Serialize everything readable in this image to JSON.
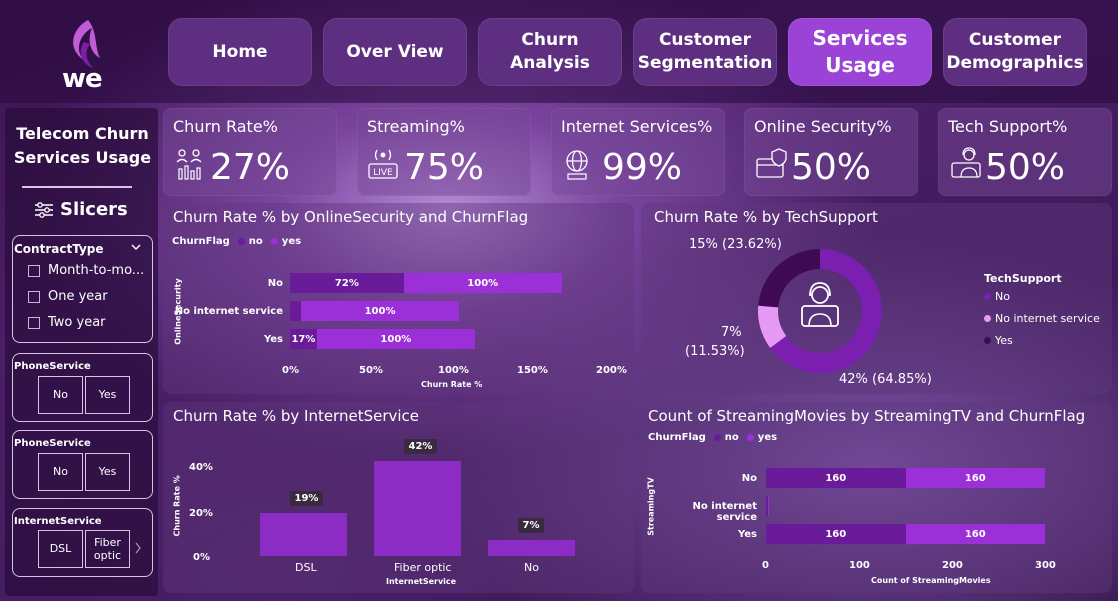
{
  "nav": {
    "home": "Home",
    "overview": "Over View",
    "churn_analysis": "Churn Analysis",
    "customer_segmentation": "Customer Segmentation",
    "services_usage": "Services Usage",
    "customer_demographics": "Customer Demographics"
  },
  "brand": {
    "logo_text": "we"
  },
  "sidebar": {
    "title": "Telecom Churn Services Usage",
    "slicers_label": "Slicers",
    "contract": {
      "title": "ContractType",
      "options": [
        "Month-to-mo...",
        "One year",
        "Two year"
      ]
    },
    "phone1": {
      "title": "PhoneService",
      "options": [
        "No",
        "Yes"
      ]
    },
    "phone2": {
      "title": "PhoneService",
      "options": [
        "No",
        "Yes"
      ]
    },
    "internet": {
      "title": "InternetService",
      "options": [
        "DSL",
        "Fiber optic"
      ]
    }
  },
  "kpis": [
    {
      "label": "Churn Rate%",
      "value": "27%",
      "icon": "churn-people-icon"
    },
    {
      "label": "Streaming%",
      "value": "75%",
      "icon": "live-stream-icon"
    },
    {
      "label": "Internet Services%",
      "value": "99%",
      "icon": "globe-icon"
    },
    {
      "label": "Online Security%",
      "value": "50%",
      "icon": "security-card-icon"
    },
    {
      "label": "Tech Support%",
      "value": "50%",
      "icon": "support-agent-icon"
    }
  ],
  "colors": {
    "no": "#6a1b9a",
    "yes": "#9b30d9",
    "light": "#e79af5",
    "dark": "#3e0a52"
  },
  "chart_data": [
    {
      "type": "bar",
      "orientation": "horizontal",
      "stacked": true,
      "title": "Churn Rate % by OnlineSecurity and ChurnFlag",
      "legend_title": "ChurnFlag",
      "legend": [
        "no",
        "yes"
      ],
      "ylabel": "OnlineSecurity",
      "xlabel": "Churn Rate %",
      "categories": [
        "No",
        "No internet service",
        "Yes"
      ],
      "series": [
        {
          "name": "no",
          "values": [
            72,
            7,
            17
          ],
          "labels": [
            "72%",
            "",
            "17%"
          ]
        },
        {
          "name": "yes",
          "values": [
            100,
            100,
            100
          ],
          "labels": [
            "100%",
            "100%",
            "100%"
          ]
        }
      ],
      "xticks": [
        "0%",
        "50%",
        "100%",
        "150%",
        "200%"
      ],
      "xlim": [
        0,
        200
      ]
    },
    {
      "type": "pie",
      "donut": true,
      "title": "Churn Rate % by TechSupport",
      "legend_title": "TechSupport",
      "legend": [
        "No",
        "No internet service",
        "Yes"
      ],
      "slices": [
        {
          "name": "No",
          "value": 64.85,
          "label_a": "42%",
          "label_b": "(64.85%)"
        },
        {
          "name": "No internet service",
          "value": 11.53,
          "label_a": "7%",
          "label_b": "(11.53%)"
        },
        {
          "name": "Yes",
          "value": 23.62,
          "label_a": "15%",
          "label_b": "(23.62%)"
        }
      ]
    },
    {
      "type": "bar",
      "orientation": "vertical",
      "title": "Churn Rate % by InternetService",
      "ylabel": "Churn Rate %",
      "xlabel": "InternetService",
      "categories": [
        "DSL",
        "Fiber optic",
        "No"
      ],
      "values": [
        19,
        42,
        7
      ],
      "labels": [
        "19%",
        "42%",
        "7%"
      ],
      "yticks": [
        "40%",
        "20%",
        "0%"
      ],
      "ylim": [
        0,
        46
      ]
    },
    {
      "type": "bar",
      "orientation": "horizontal",
      "stacked": true,
      "title": "Count of StreamingMovies by StreamingTV and ChurnFlag",
      "legend_title": "ChurnFlag",
      "legend": [
        "no",
        "yes"
      ],
      "ylabel": "StreamingTV",
      "xlabel": "Count of StreamingMovies",
      "categories": [
        "No",
        "No internet service",
        "Yes"
      ],
      "series": [
        {
          "name": "no",
          "values": [
            160,
            0,
            160
          ],
          "labels": [
            "160",
            "",
            "160"
          ]
        },
        {
          "name": "yes",
          "values": [
            160,
            2,
            160
          ],
          "labels": [
            "160",
            "",
            "160"
          ]
        }
      ],
      "xticks": [
        "0",
        "100",
        "200",
        "300"
      ],
      "xlim": [
        0,
        320
      ]
    }
  ]
}
